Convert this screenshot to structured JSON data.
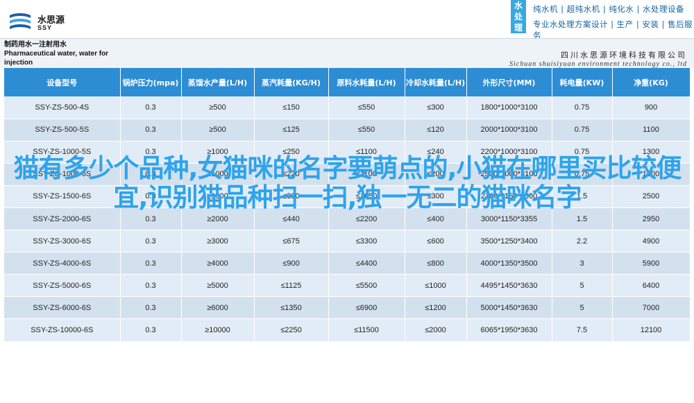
{
  "brand": {
    "logo_cn": "水思源",
    "logo_en": "SSY",
    "color": "#1f5fa8"
  },
  "slogan": {
    "vertical": [
      "水",
      "处",
      "理"
    ],
    "line1": "纯水机 | 超纯水机 | 纯化水 | 水处理设备",
    "line2": "专业水处理方案设计 | 生产 | 安装 | 售后服务"
  },
  "company": {
    "product_cn": "制药用水一注射用水",
    "product_en": "Pharmaceutical water, water for injection",
    "name_cn": "四川水思源环境科技有限公司",
    "name_en": "Sichuan shuisiyuan environment technology co., ltd"
  },
  "table": {
    "headers": [
      "设备型号",
      "锅炉压力(mpa)",
      "蒸馏水产量(L/H)",
      "蒸汽耗量(KG/H)",
      "原料水耗量(L/H)",
      "冷却水耗量(L/H)",
      "外形尺寸(MM)",
      "耗电量(KW)",
      "净重(KG)"
    ],
    "rows": [
      [
        "SSY-ZS-500-4S",
        "0.3",
        "≥500",
        "≤150",
        "≤550",
        "≤300",
        "1800*1000*3100",
        "0.75",
        "900"
      ],
      [
        "SSY-ZS-500-5S",
        "0.3",
        "≥500",
        "≤125",
        "≤550",
        "≤120",
        "2000*1000*3100",
        "0.75",
        "1100"
      ],
      [
        "SSY-ZS-1000-5S",
        "0.3",
        "≥1000",
        "≤250",
        "≤1100",
        "≤240",
        "2200*1000*3100",
        "0.75",
        "1300"
      ],
      [
        "SSY-ZS-1000-6S",
        "0.3",
        "≥1000",
        "≤220",
        "≤1100",
        "≤200",
        "2500*1000*3100",
        "0.75",
        "1500"
      ],
      [
        "SSY-ZS-1500-6S",
        "0.3",
        "≥1500",
        "≤330",
        "≤1650",
        "≤300",
        "2700*1150*3300",
        "1.5",
        "2500"
      ],
      [
        "SSY-ZS-2000-6S",
        "0.3",
        "≥2000",
        "≤440",
        "≤2200",
        "≤400",
        "3000*1150*3355",
        "1.5",
        "2950"
      ],
      [
        "SSY-ZS-3000-6S",
        "0.3",
        "≥3000",
        "≤675",
        "≤3300",
        "≤600",
        "3500*1250*3400",
        "2.2",
        "4900"
      ],
      [
        "SSY-ZS-4000-6S",
        "0.3",
        "≥4000",
        "≤900",
        "≤4400",
        "≤800",
        "4000*1350*3500",
        "3",
        "5900"
      ],
      [
        "SSY-ZS-5000-6S",
        "0.3",
        "≥5000",
        "≤1125",
        "≤5500",
        "≤1000",
        "4495*1450*3630",
        "5",
        "6400"
      ],
      [
        "SSY-ZS-6000-6S",
        "0.3",
        "≥6000",
        "≤1350",
        "≤6900",
        "≤1200",
        "5000*1450*3630",
        "5",
        "7000"
      ],
      [
        "SSY-ZS-10000-6S",
        "0.3",
        "≥10000",
        "≤2250",
        "≤11500",
        "≤2000",
        "6065*1950*3630",
        "7.5",
        "12100"
      ]
    ]
  },
  "overlay_title": "猫有多少个品种,女猫咪的名字要萌点的,小猫在哪里买比较便宜,识别猫品种扫一扫,独一无二的猫咪名字"
}
